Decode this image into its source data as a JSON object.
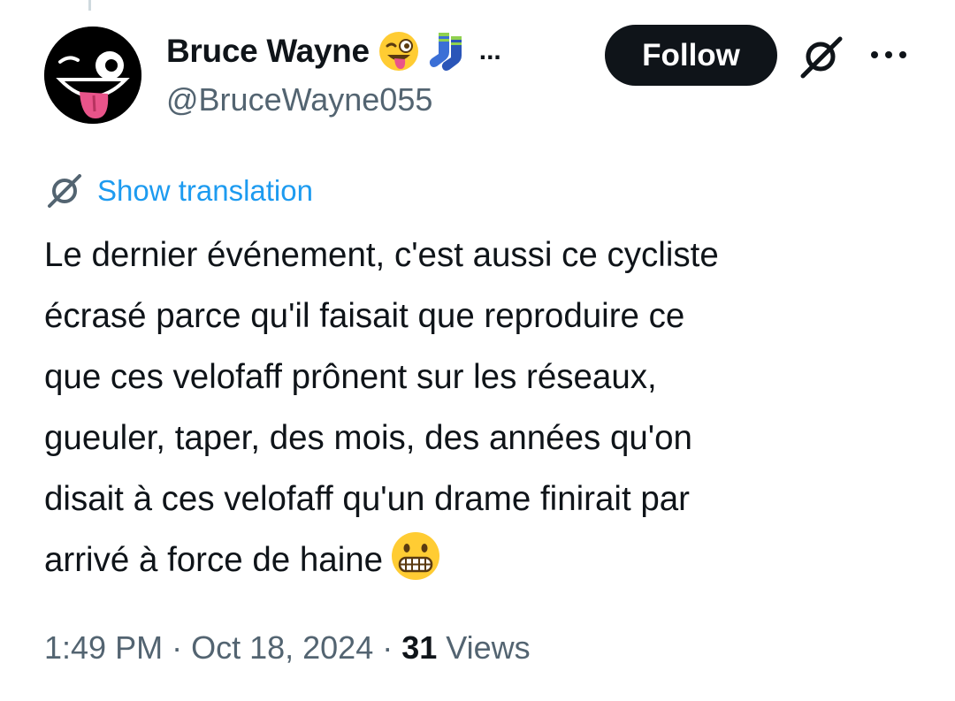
{
  "author": {
    "display_name": "Bruce Wayne",
    "name_emojis": [
      "winking-face-with-tongue-emoji",
      "socks-emoji"
    ],
    "name_truncation": "...",
    "handle": "@BruceWayne055",
    "avatar": "winking-face-with-tongue-emoji"
  },
  "actions": {
    "follow_label": "Follow",
    "grok_icon": "grok-icon",
    "more_icon": "more-options-icon"
  },
  "translation": {
    "link_label": "Show translation",
    "icon": "grok-translate-icon"
  },
  "tweet": {
    "text": "Le dernier événement, c'est aussi ce cycliste\nécrasé parce qu'il faisait que reproduire ce\nque ces velofaff prônent sur les réseaux,\ngueuler, taper, des mois, des années qu'on\ndisait à ces velofaff qu'un drame finirait par\narrivé à force de haine",
    "trailing_emoji": "grimacing-face-emoji"
  },
  "meta": {
    "time": "1:49 PM",
    "separator": " · ",
    "date": "Oct 18, 2024",
    "views_count": "31",
    "views_label": " Views"
  },
  "colors": {
    "link": "#1d9bf0",
    "secondary_text": "#536471",
    "primary_text": "#0f1419",
    "button_bg": "#0f1419"
  }
}
